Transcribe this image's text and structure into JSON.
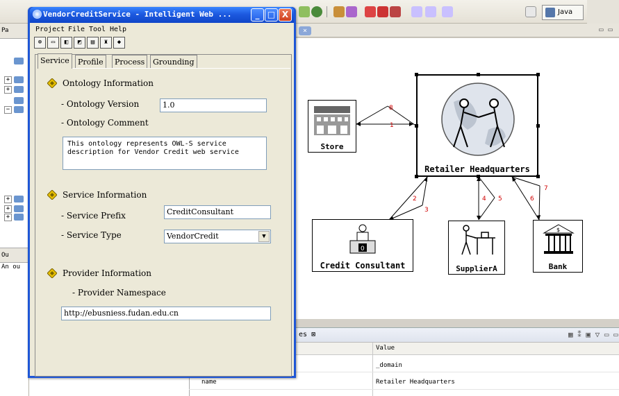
{
  "window": {
    "title": "VendorCreditService - Intelligent Web ...",
    "menu": [
      "Project",
      "File",
      "Tool",
      "Help"
    ],
    "controls": {
      "minimize": "_",
      "maximize": "□",
      "close": "X"
    }
  },
  "tabs": [
    "Service",
    "Profile",
    "Process",
    "Grounding"
  ],
  "active_tab": "Service",
  "ontology": {
    "section_title": "Ontology Information",
    "version_label": "- Ontology Version",
    "version_value": "1.0",
    "comment_label": "- Ontology Comment",
    "comment_value": "This ontology represents OWL-S service\ndescription for Vendor Credit web service"
  },
  "service": {
    "section_title": "Service Information",
    "prefix_label": "- Service Prefix",
    "prefix_value": "CreditConsultant",
    "type_label": "- Service Type",
    "type_value": "VendorCredit"
  },
  "provider": {
    "section_title": "Provider Information",
    "namespace_label": "- Provider Namespace",
    "namespace_value": "http://ebusniess.fudan.edu.cn"
  },
  "eclipse": {
    "perspective_button": "Java",
    "left_tab": "Pa",
    "outline_tab": "Ou",
    "outline_text": "An ou",
    "properties_tab": "es",
    "properties_header_value": "Value",
    "property_rows": [
      {
        "key": "",
        "value": "_domain"
      },
      {
        "key": "name",
        "value": "Retailer Headquarters"
      }
    ]
  },
  "diagram": {
    "nodes": {
      "hq": "Retailer Headquarters",
      "store": "Store",
      "credit": "Credit Consultant",
      "supplier": "SupplierA",
      "bank": "Bank"
    },
    "edge_labels": [
      "8",
      "1",
      "2",
      "3",
      "4",
      "5",
      "6",
      "7"
    ]
  },
  "colors": {
    "title_blue": "#1e56d6",
    "edge_label_red": "#d00000",
    "section_diamond": "#e8c000"
  }
}
